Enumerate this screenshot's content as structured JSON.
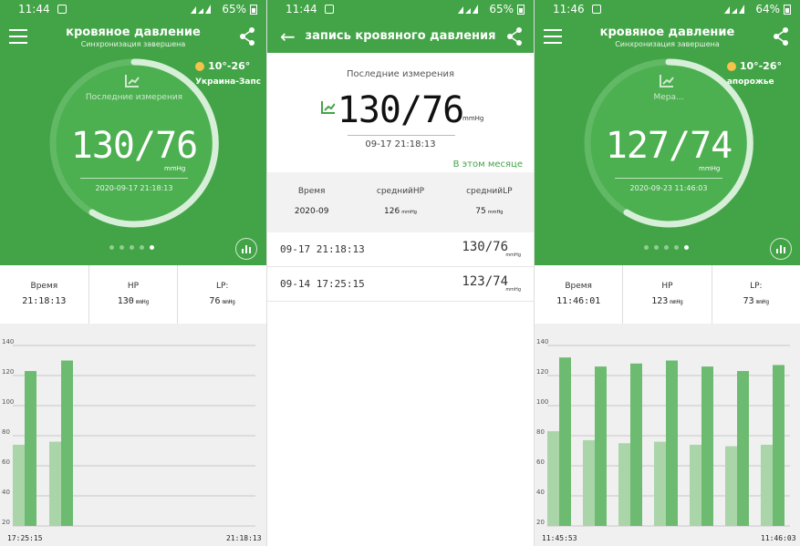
{
  "colors": {
    "accent": "#43a447",
    "bar_light": "#a9d5a9",
    "bar_dark": "#6dbb70"
  },
  "panel1": {
    "status": {
      "time": "11:44",
      "battery": "65%"
    },
    "title": "кровяное давление",
    "subtitle": "Синхронизация завершена",
    "weather": {
      "temp": "10°-26°",
      "place": "Украина-Запс"
    },
    "ring_label": "Последние измерения",
    "value": "130/76",
    "unit": "mmHg",
    "date": "2020-09-17 21:18:13",
    "stats": {
      "time_label": "Время",
      "time_value": "21:18:13",
      "hp_label": "HP",
      "hp_value": "130",
      "hp_unit": "mmHg",
      "lp_label": "LP:",
      "lp_value": "76",
      "lp_unit": "mmHg"
    },
    "chart_data": {
      "type": "bar",
      "x_start": "17:25:15",
      "x_end": "21:18:13",
      "ylim": [
        20,
        140
      ],
      "yticks": [
        20,
        40,
        60,
        80,
        100,
        120,
        140
      ],
      "series": [
        {
          "values": [
            74,
            76
          ]
        },
        {
          "values": [
            123,
            130
          ]
        }
      ]
    }
  },
  "panel2": {
    "status": {
      "time": "11:44",
      "battery": "65%"
    },
    "title": "запись кровяного давления",
    "label": "Последние измерения",
    "value": "130/76",
    "unit": "mmHg",
    "date": "09-17 21:18:13",
    "month": "В этом месяце",
    "summary": {
      "time_label": "Время",
      "time_value": "2020-09",
      "hp_label": "среднийHP",
      "hp_value": "126",
      "hp_unit": "mmHg",
      "lp_label": "среднийLP",
      "lp_value": "75",
      "lp_unit": "mmHg"
    },
    "rows": [
      {
        "date": "09-17 21:18:13",
        "value": "130/76",
        "unit": "mmHg"
      },
      {
        "date": "09-14 17:25:15",
        "value": "123/74",
        "unit": "mmHg"
      }
    ]
  },
  "panel3": {
    "status": {
      "time": "11:46",
      "battery": "64%"
    },
    "title": "кровяное давление",
    "subtitle": "Синхронизация завершена",
    "weather": {
      "temp": "10°-26°",
      "place": "апорожье"
    },
    "ring_label": "Мера...",
    "value": "127/74",
    "unit": "mmHg",
    "date": "2020-09-23 11:46:03",
    "stats": {
      "time_label": "Время",
      "time_value": "11:46:01",
      "hp_label": "HP",
      "hp_value": "123",
      "hp_unit": "mmHg",
      "lp_label": "LP:",
      "lp_value": "73",
      "lp_unit": "mmHg"
    },
    "chart_data": {
      "type": "bar",
      "x_start": "11:45:53",
      "x_end": "11:46:03",
      "ylim": [
        20,
        140
      ],
      "yticks": [
        20,
        40,
        60,
        80,
        100,
        120,
        140
      ],
      "series": [
        {
          "values": [
            83,
            77,
            75,
            76,
            74,
            73,
            74
          ]
        },
        {
          "values": [
            132,
            126,
            128,
            130,
            126,
            123,
            127
          ]
        }
      ]
    }
  }
}
